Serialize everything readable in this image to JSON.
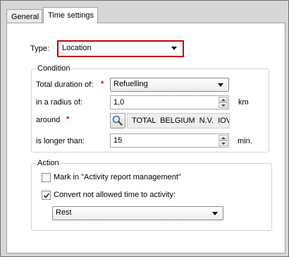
{
  "tabs": [
    {
      "label": "General"
    },
    {
      "label": "Time settings"
    }
  ],
  "type_field": {
    "label": "Type:",
    "value": "Location"
  },
  "condition": {
    "legend": "Condition",
    "total_duration": {
      "label": "Total duration of:",
      "required": "*",
      "value": "Refuelling"
    },
    "radius": {
      "label": "in a radius of:",
      "value": "1,0",
      "unit": "km"
    },
    "around": {
      "label": "around",
      "required": "*",
      "value": "TOTAL  BELGIUM N.V.    IOV"
    },
    "longer_than": {
      "label": "is longer than:",
      "value": "15",
      "unit": "min."
    }
  },
  "action": {
    "legend": "Action",
    "mark_checkbox": {
      "label": "Mark in \"Activity report management\"",
      "checked": false
    },
    "convert_checkbox": {
      "label": "Convert not allowed time to activity:",
      "checked": true
    },
    "activity": {
      "value": "Rest"
    }
  },
  "icons": {
    "search": "magnifier-icon",
    "check": "checkmark-icon"
  }
}
